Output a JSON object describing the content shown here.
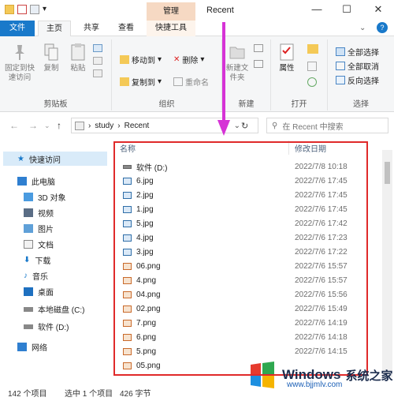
{
  "window": {
    "title": "Recent",
    "manage_tab": "管理"
  },
  "ribbon_tabs": [
    "文件",
    "主页",
    "共享",
    "查看",
    "快捷工具"
  ],
  "ribbon": {
    "clipboard": {
      "pin": "固定到快速访问",
      "copy": "复制",
      "paste": "粘贴",
      "label": "剪贴板"
    },
    "organize": {
      "move_to": "移动到",
      "copy_to": "复制到",
      "delete": "删除",
      "rename": "重命名",
      "label": "组织"
    },
    "new": {
      "new_folder": "新建文件夹",
      "label": "新建"
    },
    "open": {
      "properties": "属性",
      "label": "打开"
    },
    "select": {
      "select_all": "全部选择",
      "select_none": "全部取消",
      "invert": "反向选择",
      "label": "选择"
    }
  },
  "address": {
    "root": "study",
    "current": "Recent",
    "sep": "›"
  },
  "search": {
    "placeholder": "在 Recent 中搜索"
  },
  "nav": {
    "quick_access": "快速访问",
    "this_pc": "此电脑",
    "items": [
      "3D 对象",
      "视频",
      "图片",
      "文档",
      "下载",
      "音乐",
      "桌面",
      "本地磁盘 (C:)",
      "软件 (D:)"
    ],
    "network": "网络"
  },
  "columns": {
    "name": "名称",
    "date": "修改日期"
  },
  "files": [
    {
      "name": "软件 (D:)",
      "date": "2022/7/8 10:18",
      "kind": "drive"
    },
    {
      "name": "6.jpg",
      "date": "2022/7/6 17:45",
      "kind": "jpg"
    },
    {
      "name": "2.jpg",
      "date": "2022/7/6 17:45",
      "kind": "jpg"
    },
    {
      "name": "1.jpg",
      "date": "2022/7/6 17:45",
      "kind": "jpg"
    },
    {
      "name": "5.jpg",
      "date": "2022/7/6 17:42",
      "kind": "jpg"
    },
    {
      "name": "4.jpg",
      "date": "2022/7/6 17:23",
      "kind": "jpg"
    },
    {
      "name": "3.jpg",
      "date": "2022/7/6 17:22",
      "kind": "jpg"
    },
    {
      "name": "06.png",
      "date": "2022/7/6 15:57",
      "kind": "png"
    },
    {
      "name": "4.png",
      "date": "2022/7/6 15:57",
      "kind": "png"
    },
    {
      "name": "04.png",
      "date": "2022/7/6 15:56",
      "kind": "png"
    },
    {
      "name": "02.png",
      "date": "2022/7/6 15:49",
      "kind": "png"
    },
    {
      "name": "7.png",
      "date": "2022/7/6 14:19",
      "kind": "png"
    },
    {
      "name": "6.png",
      "date": "2022/7/6 14:18",
      "kind": "png"
    },
    {
      "name": "5.png",
      "date": "2022/7/6 14:15",
      "kind": "png"
    },
    {
      "name": "05.png",
      "date": "",
      "kind": "png"
    }
  ],
  "status": {
    "count": "142 个项目",
    "selected": "选中 1 个项目",
    "size": "426 字节"
  },
  "watermark": {
    "brand": "Windows",
    "cn": "系统之家",
    "url": "www.bjjmlv.com"
  },
  "colors": {
    "accent": "#1979ca",
    "highlight": "#e02a2a",
    "arrow": "#d633d6"
  }
}
